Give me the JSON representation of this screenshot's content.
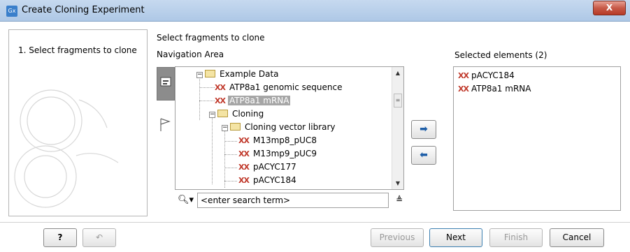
{
  "window": {
    "app_icon": "Gx",
    "title": "Create Cloning Experiment",
    "close_label": "X"
  },
  "steps": [
    {
      "label": "1.  Select fragments to clone"
    }
  ],
  "main": {
    "header": "Select fragments to clone",
    "navigation_title": "Navigation Area",
    "selected_title": "Selected elements (2)"
  },
  "tree": {
    "items": [
      {
        "label": "Example Data",
        "type": "folder",
        "expanded": true
      },
      {
        "label": "ATP8a1 genomic sequence",
        "type": "sequence"
      },
      {
        "label": "ATP8a1 mRNA",
        "type": "sequence",
        "highlighted": true
      },
      {
        "label": "Cloning",
        "type": "folder",
        "expanded": true
      },
      {
        "label": "Cloning vector library",
        "type": "folder",
        "expanded": true
      },
      {
        "label": "M13mp8_pUC8",
        "type": "sequence"
      },
      {
        "label": "M13mp9_pUC9",
        "type": "sequence"
      },
      {
        "label": "pACYC177",
        "type": "sequence"
      },
      {
        "label": "pACYC184",
        "type": "sequence"
      }
    ],
    "expand_symbol": "−",
    "dna_symbol": "XX"
  },
  "search": {
    "placeholder": "<enter search term>",
    "value": "<enter search term>",
    "icon": "search-icon"
  },
  "selected": {
    "items": [
      {
        "label": "pACYC184"
      },
      {
        "label": "ATP8a1 mRNA"
      }
    ]
  },
  "buttons": {
    "help": "?",
    "reset": "↶",
    "add": "➡",
    "remove": "⬅",
    "previous": "Previous",
    "next": "Next",
    "finish": "Finish",
    "cancel": "Cancel"
  },
  "colors": {
    "titlebar": "#aec8e6",
    "close": "#c75a48",
    "dna_icon": "#c0392b",
    "highlight": "#a6a6a6"
  }
}
